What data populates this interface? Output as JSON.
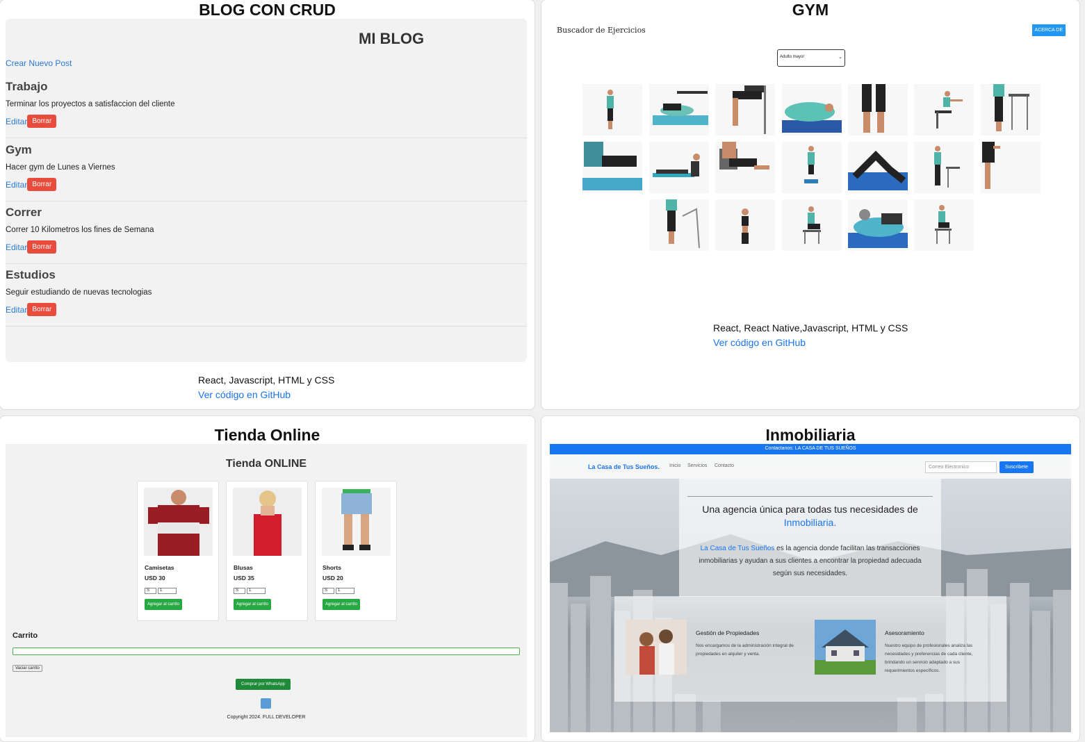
{
  "cards": {
    "blog": {
      "title": "BLOG CON CRUD",
      "tech": "React, Javascript, HTML y CSS",
      "github": "Ver código en GitHub"
    },
    "gym": {
      "title": "GYM",
      "tech": "React, React Native,Javascript, HTML y CSS",
      "github": "Ver código en GitHub"
    },
    "store": {
      "title": "Tienda Online"
    },
    "realestate": {
      "title": "Inmobiliaria"
    }
  },
  "blog": {
    "heading": "MI BLOG",
    "create_label": "Crear Nuevo Post",
    "edit_label": "Editar",
    "delete_label": "Borrar",
    "posts": [
      {
        "title": "Trabajo",
        "body": "Terminar los proyectos a satisfaccion del cliente"
      },
      {
        "title": "Gym",
        "body": "Hacer gym de Lunes a Viernes"
      },
      {
        "title": "Correr",
        "body": "Correr 10 Kilometros los fines de Semana"
      },
      {
        "title": "Estudios",
        "body": "Seguir estudiando de nuevas tecnologias"
      }
    ]
  },
  "gym": {
    "app_title": "Buscador de Ejercicios",
    "about_button": "ACERCA DE",
    "filter_value": "Adulto mayor"
  },
  "store": {
    "heading": "Tienda ONLINE",
    "products": [
      {
        "name": "Camisetas",
        "price": "USD 30",
        "size": "S",
        "qty": "1",
        "add_label": "Agregar al carrito",
        "color": "#9b1d24"
      },
      {
        "name": "Blusas",
        "price": "USD 35",
        "size": "S",
        "qty": "1",
        "add_label": "Agregar al carrito",
        "color": "#d11d2e"
      },
      {
        "name": "Shorts",
        "price": "USD 20",
        "size": "S",
        "qty": "1",
        "add_label": "Agregar al carrito",
        "color": "#8fb3d6"
      }
    ],
    "cart_title": "Carrito",
    "empty_cart": "Vaciar carrito",
    "whatsapp": "Comprar por WhatsApp",
    "copyright": "Copyright 2024. FULL DEVELOPER"
  },
  "realestate": {
    "topbar": "Contactanos: LA CASA DE TUS SUEÑOS",
    "brand": "La Casa de Tus Sueños.",
    "nav": [
      "Inicio",
      "Servicios",
      "Contacto"
    ],
    "email_placeholder": "Correo Electronico",
    "subscribe": "Suscribete",
    "headline_a": "Una agencia única para todas tus necesidades de",
    "headline_b": "Inmobiliaria.",
    "intro_brand": "La Casa de Tus Sueños",
    "intro_rest": "es la agencia donde facilitan las transacciones inmobiliarias y ayudan a sus clientes a encontrar la propiedad adecuada según sus necesidades.",
    "services": [
      {
        "title": "Gestión de Propiedades",
        "desc": "Nos encargamos de la administración integral de propiedades en alquiler y venta."
      },
      {
        "title": "Asesoramiento",
        "desc": "Nuestro equipo de profesionales analiza las necesidades y preferencias de cada cliente, brindando un servicio adaptado a sus requerimientos específicos."
      }
    ]
  }
}
